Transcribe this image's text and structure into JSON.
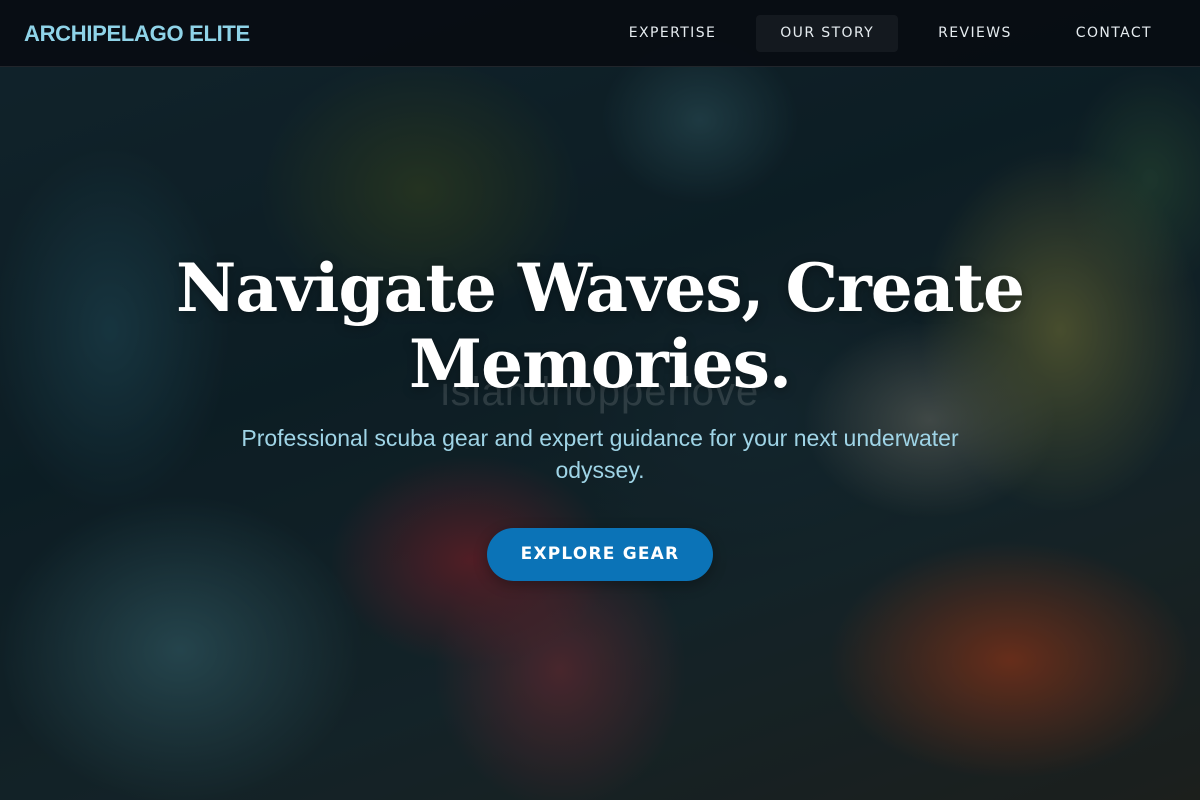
{
  "nav": {
    "brand": "ARCHIPELAGO ELITE",
    "links": [
      {
        "label": "EXPERTISE"
      },
      {
        "label": "OUR STORY"
      },
      {
        "label": "REVIEWS"
      },
      {
        "label": "CONTACT"
      }
    ],
    "active_link": "OUR STORY"
  },
  "hero": {
    "title": "Navigate Waves, Create Memories.",
    "subtitle": "Professional scuba gear and expert guidance for your next underwater odyssey.",
    "cta_label": "EXPLORE GEAR",
    "watermark": "islandhopperlove"
  },
  "colors": {
    "brand": "#8fd3e8",
    "subtitle": "#9fd4e6",
    "cta": "#0b73b7",
    "nav_bg": "#080c12"
  }
}
